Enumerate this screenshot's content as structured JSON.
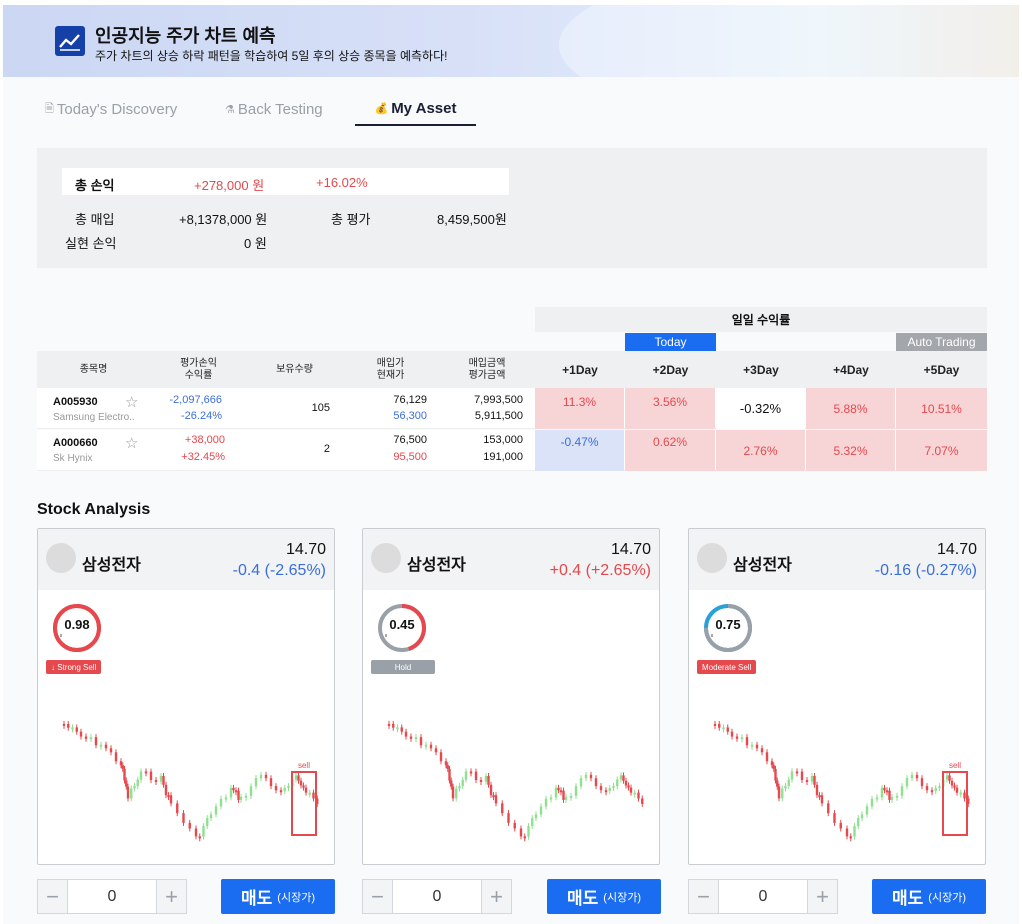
{
  "header": {
    "title": "인공지능 주가 차트 예측",
    "subtitle": "주가 차트의 상승 하락 패턴을 학습하여 5일 후의 상승 종목을 예측하다!"
  },
  "tabs": [
    {
      "label": "Today's Discovery",
      "icon": "document-icon",
      "active": false
    },
    {
      "label": "Back Testing",
      "icon": "flask-icon",
      "active": false
    },
    {
      "label": "My Asset",
      "icon": "money-bag-icon",
      "active": true
    }
  ],
  "summary": {
    "total_pnl_label": "총 손익",
    "total_pnl_value": "+278,000 원",
    "total_pnl_pct": "+16.02%",
    "total_buy_label": "총 매입",
    "total_buy_value": "+8,1378,000 원",
    "total_eval_label": "총 평가",
    "total_eval_value": "8,459,500원",
    "realized_label": "실현 손익",
    "realized_value": "0 원"
  },
  "table": {
    "daily_header": "일일 수익률",
    "today_tag": "Today",
    "auto_tag": "Auto Trading",
    "headers": {
      "name": "종목명",
      "pnl_l1": "평가손익",
      "pnl_l2": "수익률",
      "qty": "보유수량",
      "price_l1": "매입가",
      "price_l2": "현재가",
      "amount_l1": "매입금액",
      "amount_l2": "평가금액",
      "d1": "+1Day",
      "d2": "+2Day",
      "d3": "+3Day",
      "d4": "+4Day",
      "d5": "+5Day"
    },
    "rows": [
      {
        "code": "A005930",
        "name": "Samsung Electro..",
        "pnl": "-2,097,666",
        "pnl_pct": "-26.24%",
        "qty": "105",
        "buy_price": "76,129",
        "cur_price": "56,300",
        "buy_amount": "7,993,500",
        "eval_amount": "5,911,500",
        "days": [
          "11.3%",
          "3.56%",
          "-0.32%",
          "5.88%",
          "10.51%"
        ]
      },
      {
        "code": "A000660",
        "name": "Sk Hynix",
        "pnl": "+38,000",
        "pnl_pct": "+32.45%",
        "qty": "2",
        "buy_price": "76,500",
        "cur_price": "95,500",
        "buy_amount": "153,000",
        "eval_amount": "191,000",
        "days": [
          "-0.47%",
          "0.62%",
          "2.76%",
          "5.32%",
          "7.07%"
        ]
      }
    ]
  },
  "analysis": {
    "title": "Stock Analysis",
    "cards": [
      {
        "name": "삼성전자",
        "price": "14.70",
        "change": "-0.4 (-2.65%)",
        "direction": "down",
        "score": "0.98",
        "score_frac": 0.98,
        "badge": "↓ Strong Sell",
        "badge_color": "#e5484d",
        "signal_label": "sell",
        "qty": "0",
        "sell_label": "매도",
        "sell_sub": "(시장가)"
      },
      {
        "name": "삼성전자",
        "price": "14.70",
        "change": "+0.4 (+2.65%)",
        "direction": "up",
        "score": "0.45",
        "score_frac": 0.45,
        "badge": "Hold",
        "badge_color": "#9aa0a8",
        "signal_label": "",
        "qty": "0",
        "sell_label": "매도",
        "sell_sub": "(시장가)"
      },
      {
        "name": "삼성전자",
        "price": "14.70",
        "change": "-0.16 (-0.27%)",
        "direction": "down",
        "score": "0.75",
        "score_frac": 0.75,
        "badge": "Moderate Sell",
        "badge_color": "#e5484d",
        "signal_label": "sell",
        "qty": "0",
        "sell_label": "매도",
        "sell_sub": "(시장가)"
      }
    ]
  },
  "colors": {
    "accent": "#1a6cf0",
    "up": "#e5484d",
    "down": "#3b6fd8"
  }
}
